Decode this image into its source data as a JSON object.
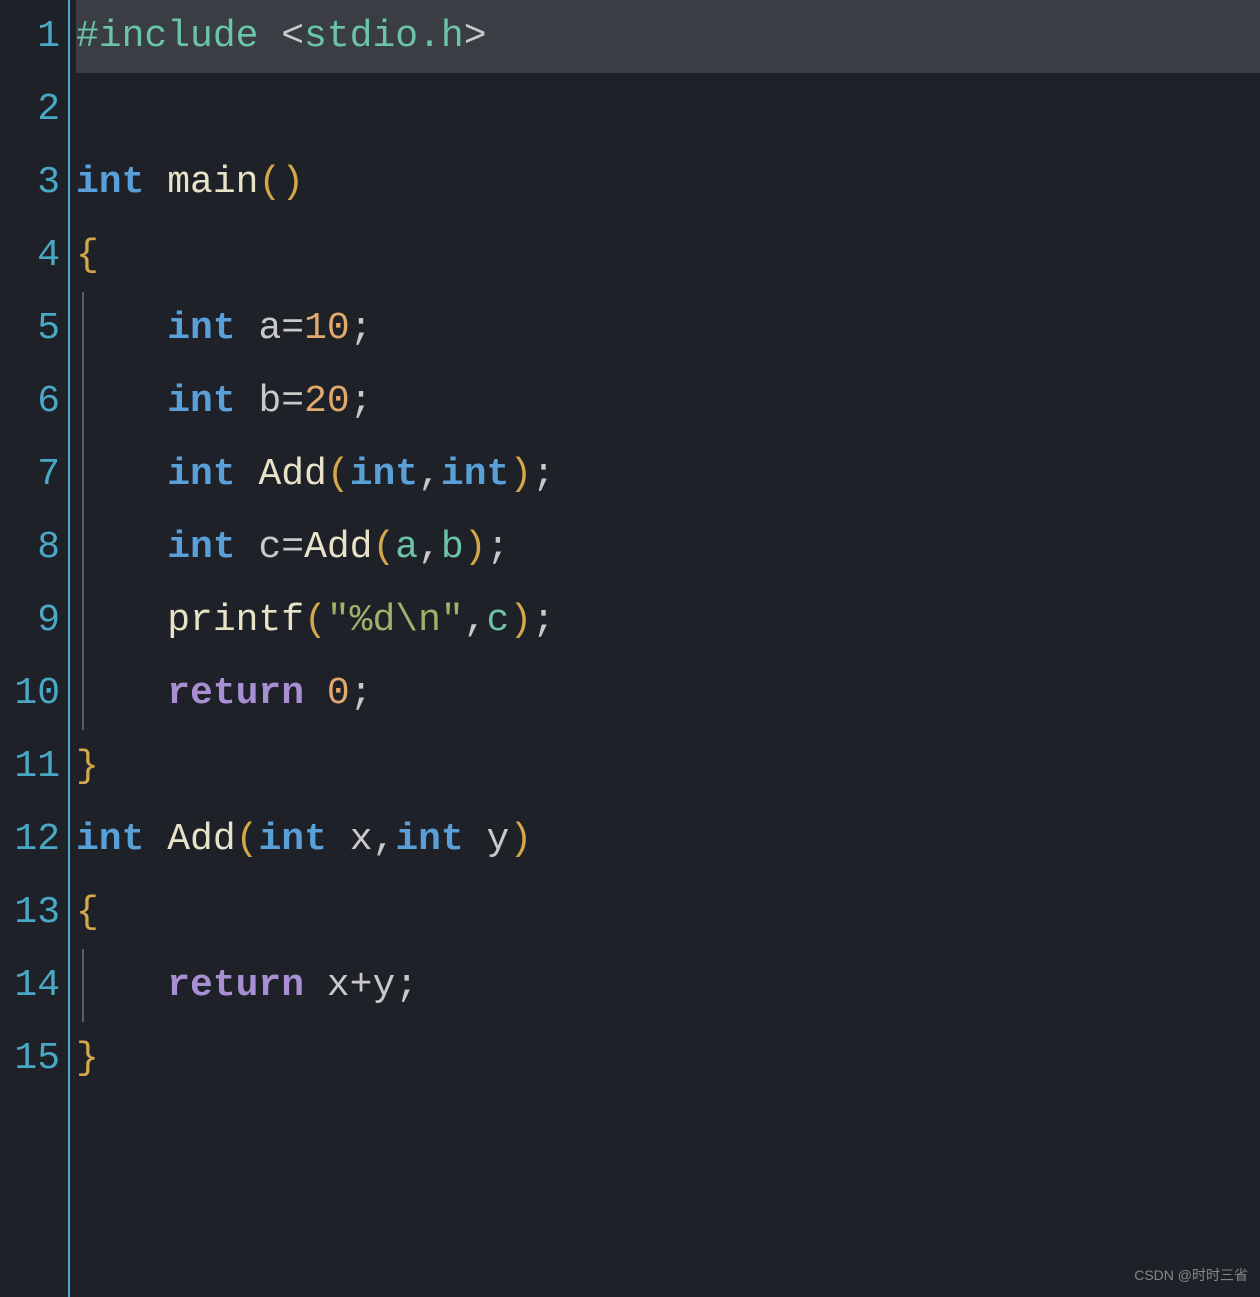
{
  "lineNumbers": [
    "1",
    "2",
    "3",
    "4",
    "5",
    "6",
    "7",
    "8",
    "9",
    "10",
    "11",
    "12",
    "13",
    "14",
    "15"
  ],
  "code": {
    "line1": {
      "include": "#include",
      "lt": " <",
      "header": "stdio.h",
      "gt": ">"
    },
    "line3": {
      "int": "int",
      "sp": " ",
      "main": "main",
      "paren": "()"
    },
    "line4": {
      "brace": "{"
    },
    "line5": {
      "indent": "    ",
      "int": "int",
      "name": " a=",
      "num": "10",
      "semi": ";"
    },
    "line6": {
      "indent": "    ",
      "int": "int",
      "name": " b=",
      "num": "20",
      "semi": ";"
    },
    "line7": {
      "indent": "    ",
      "int1": "int",
      "sp1": " ",
      "fn": "Add",
      "lp": "(",
      "int2": "int",
      "comma": ",",
      "int3": "int",
      "rp": ")",
      "semi": ";"
    },
    "line8": {
      "indent": "    ",
      "int": "int",
      "name": " c=",
      "fn": "Add",
      "lp": "(",
      "a": "a",
      "comma": ",",
      "b": "b",
      "rp": ")",
      "semi": ";"
    },
    "line9": {
      "indent": "    ",
      "fn": "printf",
      "lp": "(",
      "str1": "\"%d",
      "esc": "\\n",
      "str2": "\"",
      "comma": ",",
      "c": "c",
      "rp": ")",
      "semi": ";"
    },
    "line10": {
      "indent": "    ",
      "return": "return",
      "sp": " ",
      "num": "0",
      "semi": ";"
    },
    "line11": {
      "brace": "}"
    },
    "line12": {
      "int1": "int",
      "sp1": " ",
      "fn": "Add",
      "lp": "(",
      "int2": "int",
      "x": " x",
      "comma": ",",
      "int3": "int",
      "y": " y",
      "rp": ")"
    },
    "line13": {
      "brace": "{"
    },
    "line14": {
      "indent": "    ",
      "return": "return",
      "expr": " x+y",
      "semi": ";"
    },
    "line15": {
      "brace": "}"
    }
  },
  "watermark": "CSDN @时时三省"
}
